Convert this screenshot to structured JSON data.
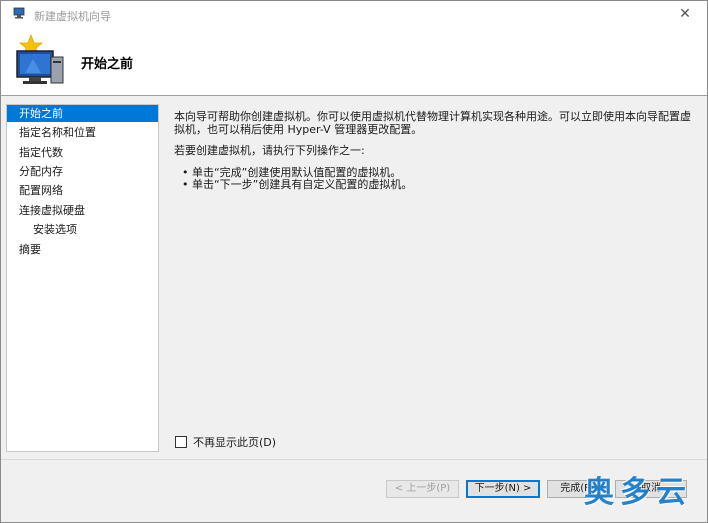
{
  "window": {
    "title": "新建虚拟机向导",
    "close_glyph": "✕"
  },
  "header": {
    "title": "开始之前"
  },
  "nav": {
    "items": [
      {
        "label": "开始之前",
        "active": true
      },
      {
        "label": "指定名称和位置"
      },
      {
        "label": "指定代数"
      },
      {
        "label": "分配内存"
      },
      {
        "label": "配置网络"
      },
      {
        "label": "连接虚拟硬盘"
      },
      {
        "label": "安装选项"
      },
      {
        "label": "摘要"
      }
    ]
  },
  "content": {
    "intro": "本向导可帮助你创建虚拟机。你可以使用虚拟机代替物理计算机实现各种用途。可以立即使用本向导配置虚拟机，也可以稍后使用 Hyper-V 管理器更改配置。",
    "prompt": "若要创建虚拟机，请执行下列操作之一:",
    "bullets": [
      "• 单击“完成”创建使用默认值配置的虚拟机。",
      "• 单击“下一步”创建具有自定义配置的虚拟机。"
    ],
    "checkbox_label": "不再显示此页(D)",
    "checkbox_checked": false
  },
  "buttons": {
    "previous": "< 上一步(P)",
    "next": "下一步(N) >",
    "finish": "完成(F)",
    "cancel": "取消"
  },
  "watermark": "奥多云",
  "colors": {
    "selection": "#0078d7",
    "watermark": "#1679c9"
  }
}
